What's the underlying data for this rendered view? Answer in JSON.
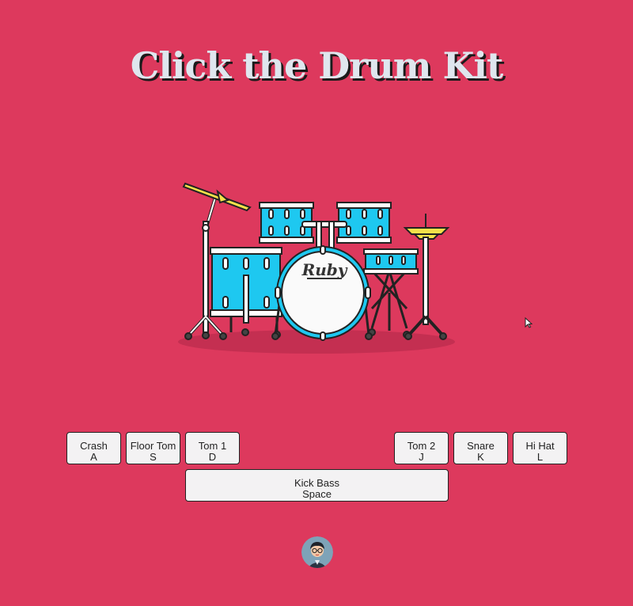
{
  "header": {
    "title": "Click the Drum Kit"
  },
  "kit": {
    "bass_brand": "Ruby"
  },
  "pads": {
    "crash": {
      "label": "Crash",
      "key": "A"
    },
    "floor_tom": {
      "label": "Floor Tom",
      "key": "S"
    },
    "tom1": {
      "label": "Tom 1",
      "key": "D"
    },
    "tom2": {
      "label": "Tom 2",
      "key": "J"
    },
    "snare": {
      "label": "Snare",
      "key": "K"
    },
    "hihat": {
      "label": "Hi Hat",
      "key": "L"
    },
    "kick": {
      "label": "Kick Bass",
      "key": "Space"
    }
  },
  "colors": {
    "background": "#dd395d",
    "drum_blue": "#1ec8f0",
    "cymbal_yellow": "#f4e24a"
  },
  "icons": {
    "avatar": "avatar-icon",
    "cursor": "mouse-pointer-icon"
  }
}
